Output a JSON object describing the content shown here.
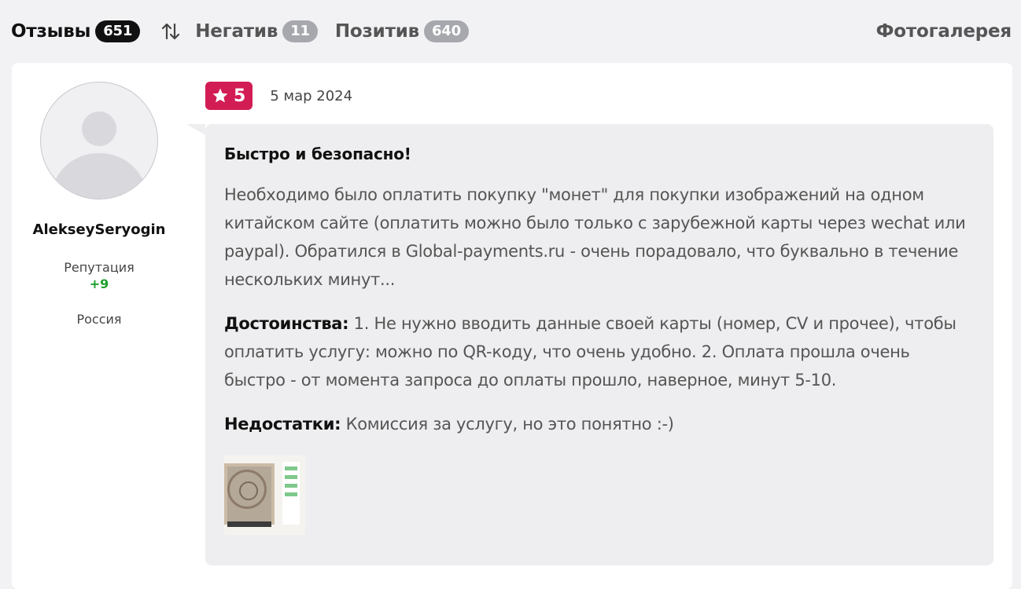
{
  "tabs": {
    "reviews": {
      "label": "Отзывы",
      "count": "651"
    },
    "negative": {
      "label": "Негатив",
      "count": "11"
    },
    "positive": {
      "label": "Позитив",
      "count": "640"
    },
    "gallery_label": "Фотогалерея",
    "sort_icon": "sort-arrows-icon"
  },
  "author": {
    "name": "AlekseySeryogin",
    "reputation_label": "Репутация",
    "reputation_value": "+9",
    "country": "Россия",
    "avatar_icon": "default-user-avatar"
  },
  "review": {
    "rating": "5",
    "rating_icon": "star-icon",
    "date": "5 мар 2024",
    "title": "Быстро и безопасно!",
    "text": "Необходимо было оплатить покупку \"монет\" для покупки изображений на одном китайском сайте (оплатить можно было только с зарубежной карты через wechat или paypal). Обратился в Global-payments.ru - очень порадовало, что буквально в течение нескольких минут...",
    "pros_label": "Достоинства:",
    "pros_text": " 1. Не нужно вводить данные своей карты (номер, CV и прочее), чтобы оплатить услугу: можно по QR-коду, что очень удобно. 2. Оплата прошла очень быстро - от момента запроса до оплаты прошло, наверное, минут 5-10.",
    "cons_label": "Недостатки:",
    "cons_text": " Комиссия за услугу, но это понятно :-)",
    "photo_count": 1
  },
  "colors": {
    "rating_badge": "#d21c54",
    "reputation_positive": "#1e9e2e",
    "active_count_bg": "#111111",
    "inactive_count_bg": "#a6a8ad",
    "page_bg": "#f2f2f4",
    "bubble_bg": "#eeeef0"
  }
}
